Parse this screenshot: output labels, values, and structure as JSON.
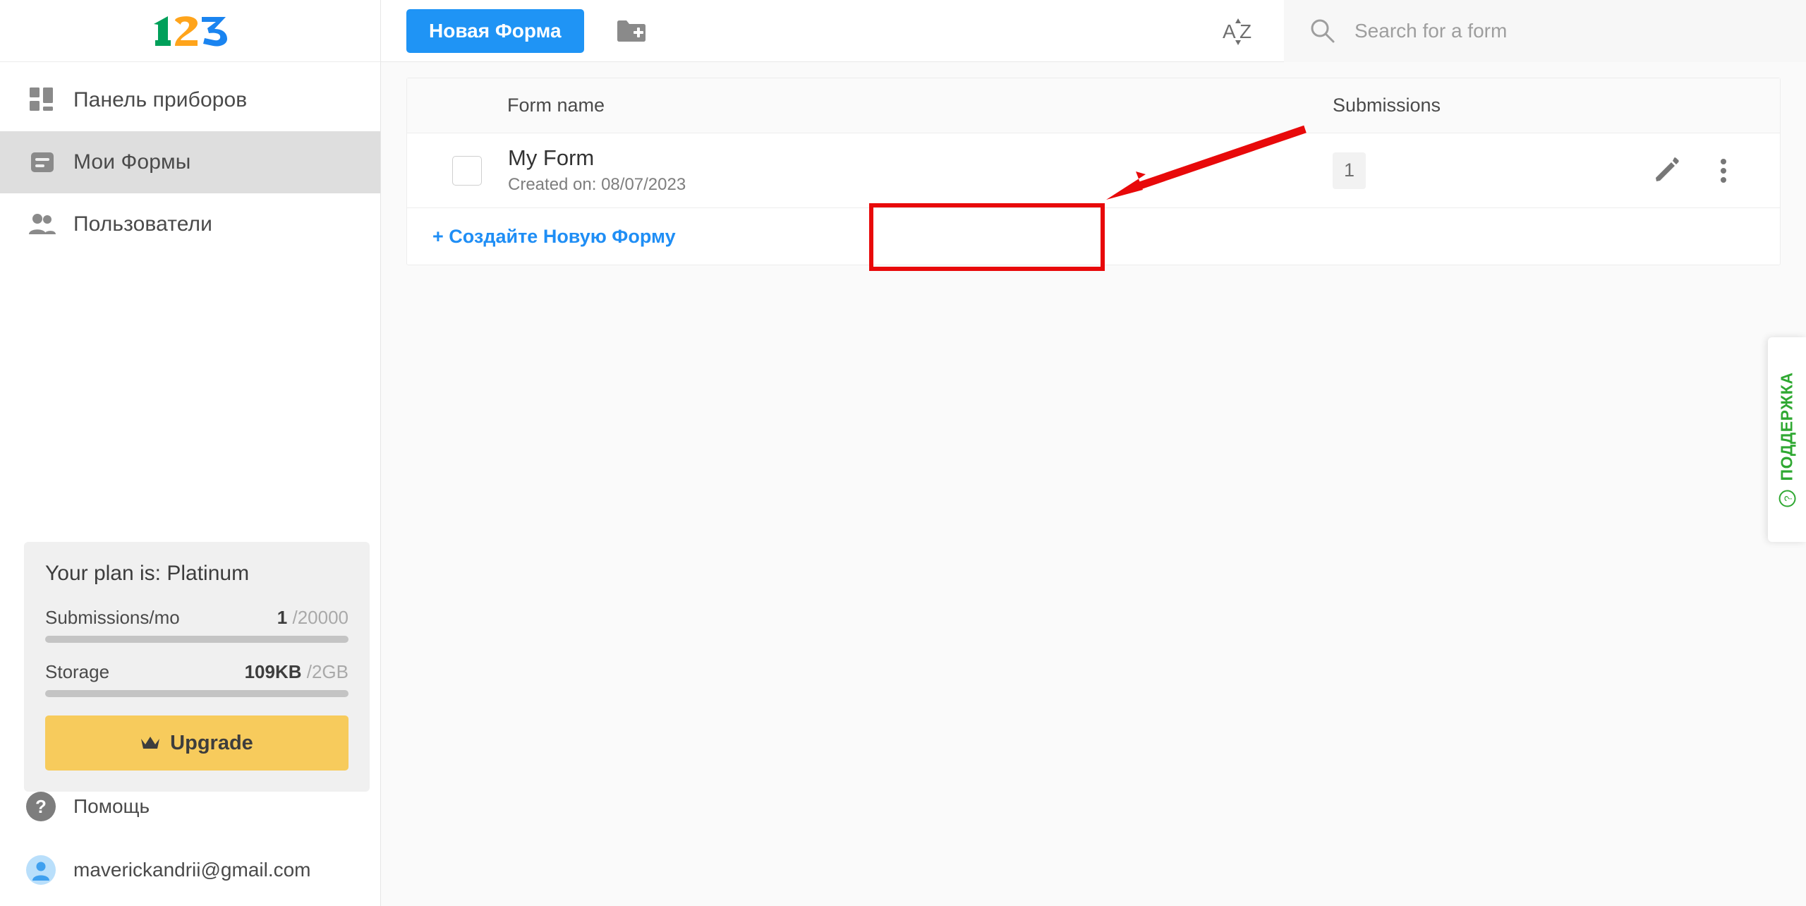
{
  "brand": {
    "logo_name": "123-form-builder-logo",
    "logo_digits": [
      "1",
      "2",
      "3"
    ],
    "colors": {
      "green": "#00a05a",
      "orange": "#ffa41b",
      "blue": "#1a84f0"
    }
  },
  "sidebar": {
    "items": [
      {
        "label": "Панель приборов",
        "icon": "dashboard-grid-icon",
        "active": false
      },
      {
        "label": "Мои Формы",
        "icon": "forms-document-icon",
        "active": true
      },
      {
        "label": "Пользователи",
        "icon": "users-group-icon",
        "active": false
      }
    ],
    "plan": {
      "title": "Your plan is: Platinum",
      "plan_name": "Platinum",
      "meters": [
        {
          "label": "Submissions/mo",
          "used": "1",
          "total": "/20000",
          "percent": 0
        },
        {
          "label": "Storage",
          "used": "109KB",
          "total": "/2GB",
          "percent": 0
        }
      ],
      "upgrade_label": "Upgrade",
      "upgrade_icon": "crown-icon",
      "upgrade_color": "#f7cb5c"
    },
    "help": {
      "label": "Помощь",
      "icon": "question-circle-icon"
    },
    "account": {
      "label": "maverickandrii@gmail.com",
      "icon": "user-avatar-icon"
    }
  },
  "toolbar": {
    "new_form_label": "Новая Форма",
    "new_form_color": "#1f94f5",
    "new_folder_icon": "folder-plus-icon",
    "sort_icon": "sort-alpha-az-icon",
    "sort_label": "AZ",
    "search": {
      "icon": "search-icon",
      "placeholder": "Search for a form",
      "value": ""
    }
  },
  "table": {
    "columns": [
      "Form name",
      "Submissions"
    ],
    "rows": [
      {
        "checkbox_checked": false,
        "name": "My Form",
        "created": "Created on: 08/07/2023",
        "submissions": "1",
        "edit_icon": "pencil-edit-icon",
        "more_icon": "more-vertical-icon"
      }
    ],
    "create_new_label": "+ Создайте Новую Форму",
    "create_new_color": "#1f8ef5"
  },
  "support_tab": {
    "label": "ПОДДЕРЖКА",
    "icon": "question-circle-icon",
    "color": "#2fa832"
  },
  "annotations": {
    "highlight_color": "#e8090a",
    "box_target": "My Form",
    "arrow_points_to": "My Form"
  }
}
